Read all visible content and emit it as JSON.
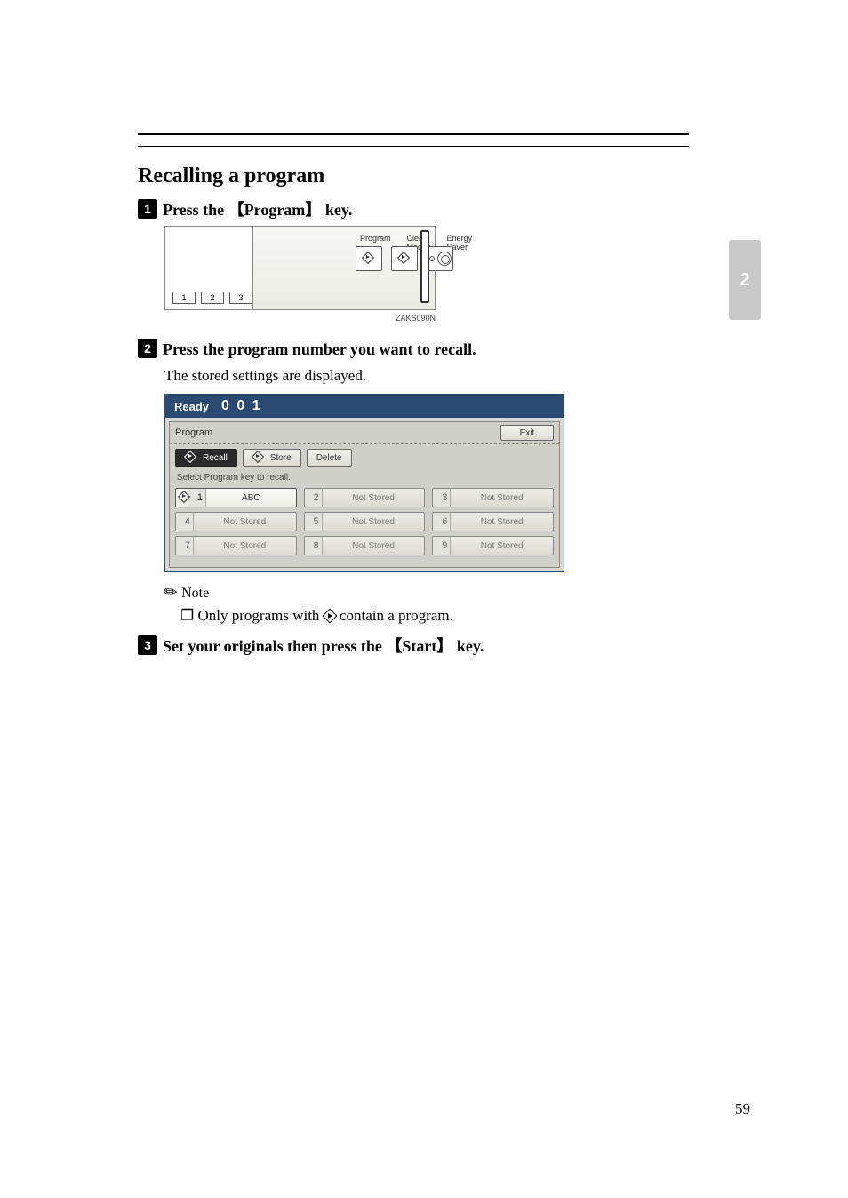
{
  "section_title": "Recalling a program",
  "side_tab": "2",
  "page_number": "59",
  "steps": {
    "s1": {
      "pre": "Press the ",
      "key": "Program",
      "post": " key."
    },
    "s2": {
      "text": "Press the program number you want to recall.",
      "body": "The stored settings are displayed."
    },
    "s3": {
      "pre": "Set your originals then press the ",
      "key": "Start",
      "post": " key."
    }
  },
  "note": {
    "label": "Note",
    "item": "Only programs with      contain a program."
  },
  "panel": {
    "labels": {
      "program": "Program",
      "clear": "Clear Modes",
      "energy": "Energy Saver"
    },
    "keys": {
      "k1": "1",
      "k2": "2",
      "k3": "3"
    },
    "code": "ZAKS090N"
  },
  "lcd": {
    "titlebar_ready": "Ready",
    "titlebar_count": "0 0 1",
    "header": "Program",
    "exit": "Exit",
    "tabs": {
      "recall": "Recall",
      "store": "Store",
      "delete": "Delete"
    },
    "hint": "Select Program key to recall.",
    "cells": {
      "c1": {
        "n": "1",
        "l": "ABC"
      },
      "c2": {
        "n": "2",
        "l": "Not Stored"
      },
      "c3": {
        "n": "3",
        "l": "Not Stored"
      },
      "c4": {
        "n": "4",
        "l": "Not Stored"
      },
      "c5": {
        "n": "5",
        "l": "Not Stored"
      },
      "c6": {
        "n": "6",
        "l": "Not Stored"
      },
      "c7": {
        "n": "7",
        "l": "Not Stored"
      },
      "c8": {
        "n": "8",
        "l": "Not Stored"
      },
      "c9": {
        "n": "9",
        "l": "Not Stored"
      }
    }
  }
}
